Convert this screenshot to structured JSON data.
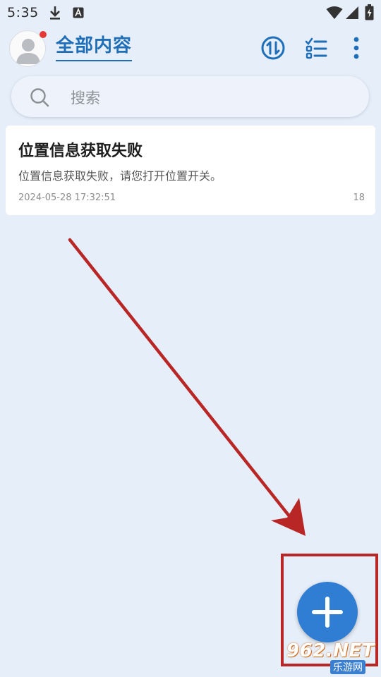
{
  "status_bar": {
    "time": "5:35",
    "icons": [
      "download-icon",
      "a-icon",
      "wifi-icon",
      "signal-icon",
      "battery-charging-icon"
    ]
  },
  "header": {
    "title": "全部内容",
    "avatar_icon": "user-avatar-icon",
    "actions": [
      "sort-icon",
      "checklist-icon",
      "more-vert-icon"
    ]
  },
  "search": {
    "placeholder": "搜索",
    "icon": "search-icon"
  },
  "notes": [
    {
      "title": "位置信息获取失败",
      "body": "位置信息获取失败，请您打开位置开关。",
      "date": "2024-05-28 17:32:51",
      "count": "18"
    }
  ],
  "fab": {
    "icon": "plus-icon"
  },
  "watermark": {
    "main": "962.NET",
    "sub": "乐游网"
  },
  "colors": {
    "accent": "#1f6fb8",
    "fab": "#2f7ed4",
    "background": "#e6eef9",
    "annotation": "#b82626",
    "badge": "#e53935"
  }
}
